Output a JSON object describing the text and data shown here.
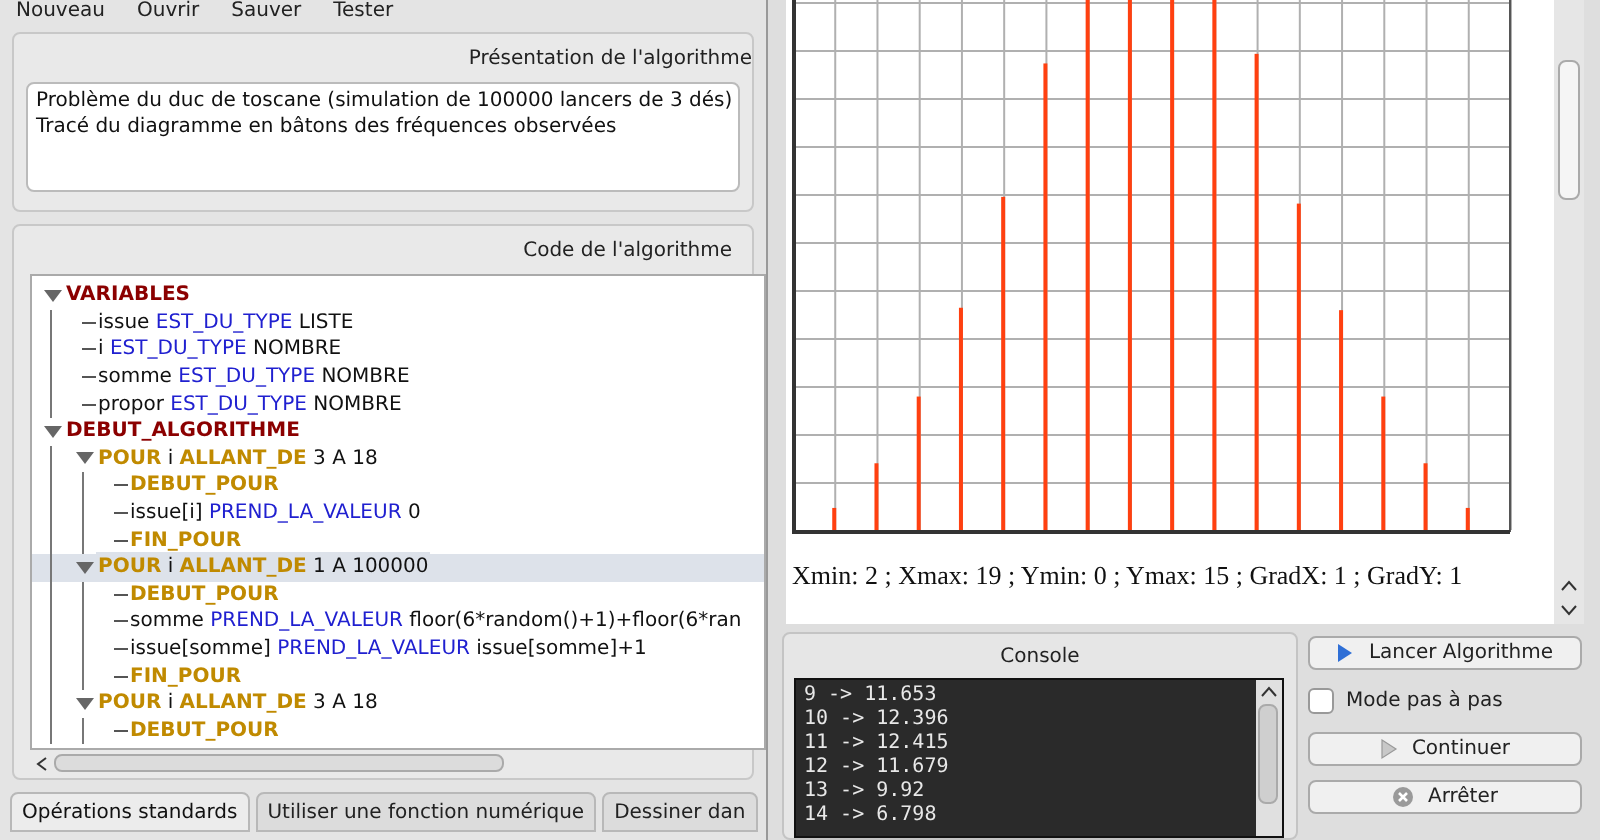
{
  "toolbar": [
    "Nouveau",
    "Ouvrir",
    "Sauver",
    "Tester"
  ],
  "presentation": {
    "title": "Présentation de l'algorithme",
    "lines": [
      "Problème du duc de toscane (simulation de 100000 lancers de 3 dés)",
      "Tracé du diagramme en bâtons des fréquences observées"
    ]
  },
  "code": {
    "title": "Code de l'algorithme",
    "tree": [
      {
        "parts": [
          {
            "text": "VARIABLES",
            "kind": "block"
          }
        ],
        "expanded": true,
        "selected": false,
        "children": [
          {
            "parts": [
              {
                "text": "issue ",
                "kind": "plain"
              },
              {
                "text": "EST_DU_TYPE",
                "kind": "keyword"
              },
              {
                "text": " LISTE",
                "kind": "plain"
              }
            ],
            "selected": false
          },
          {
            "parts": [
              {
                "text": "i ",
                "kind": "plain"
              },
              {
                "text": "EST_DU_TYPE",
                "kind": "keyword"
              },
              {
                "text": " NOMBRE",
                "kind": "plain"
              }
            ],
            "selected": false
          },
          {
            "parts": [
              {
                "text": "somme ",
                "kind": "plain"
              },
              {
                "text": "EST_DU_TYPE",
                "kind": "keyword"
              },
              {
                "text": " NOMBRE",
                "kind": "plain"
              }
            ],
            "selected": false
          },
          {
            "parts": [
              {
                "text": "propor ",
                "kind": "plain"
              },
              {
                "text": "EST_DU_TYPE",
                "kind": "keyword"
              },
              {
                "text": " NOMBRE",
                "kind": "plain"
              }
            ],
            "selected": false
          }
        ]
      },
      {
        "parts": [
          {
            "text": "DEBUT_ALGORITHME",
            "kind": "block"
          }
        ],
        "expanded": true,
        "selected": false,
        "children": [
          {
            "parts": [
              {
                "text": "POUR",
                "kind": "loop"
              },
              {
                "text": " i ",
                "kind": "plain"
              },
              {
                "text": "ALLANT_DE",
                "kind": "loop"
              },
              {
                "text": " 3 A 18",
                "kind": "plain"
              }
            ],
            "expanded": true,
            "selected": false,
            "children": [
              {
                "parts": [
                  {
                    "text": "DEBUT_POUR",
                    "kind": "loop"
                  }
                ],
                "selected": false
              },
              {
                "parts": [
                  {
                    "text": "issue[i] ",
                    "kind": "plain"
                  },
                  {
                    "text": "PREND_LA_VALEUR",
                    "kind": "keyword"
                  },
                  {
                    "text": " 0",
                    "kind": "plain"
                  }
                ],
                "selected": false
              },
              {
                "parts": [
                  {
                    "text": "FIN_POUR",
                    "kind": "loop"
                  }
                ],
                "selected": false
              }
            ]
          },
          {
            "parts": [
              {
                "text": "POUR",
                "kind": "loop"
              },
              {
                "text": " i ",
                "kind": "plain"
              },
              {
                "text": "ALLANT_DE",
                "kind": "loop"
              },
              {
                "text": " 1 A 100000",
                "kind": "plain"
              }
            ],
            "expanded": true,
            "selected": true,
            "children": [
              {
                "parts": [
                  {
                    "text": "DEBUT_POUR",
                    "kind": "loop"
                  }
                ],
                "selected": false
              },
              {
                "parts": [
                  {
                    "text": "somme ",
                    "kind": "plain"
                  },
                  {
                    "text": "PREND_LA_VALEUR",
                    "kind": "keyword"
                  },
                  {
                    "text": " floor(6*random()+1)+floor(6*ran",
                    "kind": "plain"
                  }
                ],
                "selected": false
              },
              {
                "parts": [
                  {
                    "text": "issue[somme] ",
                    "kind": "plain"
                  },
                  {
                    "text": "PREND_LA_VALEUR",
                    "kind": "keyword"
                  },
                  {
                    "text": " issue[somme]+1",
                    "kind": "plain"
                  }
                ],
                "selected": false
              },
              {
                "parts": [
                  {
                    "text": "FIN_POUR",
                    "kind": "loop"
                  }
                ],
                "selected": false
              }
            ]
          },
          {
            "parts": [
              {
                "text": "POUR",
                "kind": "loop"
              },
              {
                "text": " i ",
                "kind": "plain"
              },
              {
                "text": "ALLANT_DE",
                "kind": "loop"
              },
              {
                "text": " 3 A 18",
                "kind": "plain"
              }
            ],
            "expanded": true,
            "selected": false,
            "children": [
              {
                "parts": [
                  {
                    "text": "DEBUT_POUR",
                    "kind": "loop"
                  }
                ],
                "selected": false
              }
            ]
          }
        ]
      }
    ]
  },
  "tabs": [
    {
      "label": "Opérations standards",
      "selected": true
    },
    {
      "label": "Utiliser une fonction numérique",
      "selected": false
    },
    {
      "label": "Dessiner dan",
      "selected": false
    }
  ],
  "graph": {
    "settings": "Xmin: 2 ; Xmax: 19 ; Ymin: 0 ; Ymax: 15 ; GradX: 1 ; GradY: 1"
  },
  "console": {
    "title": "Console",
    "lines": [
      "9 -> 11.653",
      "10 -> 12.396",
      "11 -> 12.415",
      "12 -> 11.679",
      "13 -> 9.92",
      "14 -> 6.798"
    ]
  },
  "controls": {
    "run": "Lancer Algorithme",
    "step_mode": {
      "label": "Mode pas à pas",
      "checked": false
    },
    "continue": "Continuer",
    "stop": "Arrêter"
  }
}
